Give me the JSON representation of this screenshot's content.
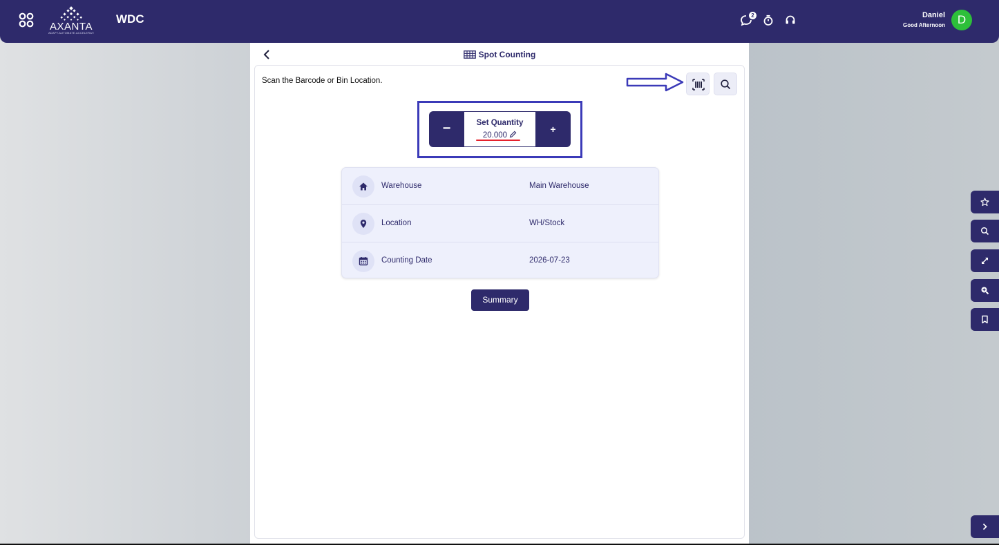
{
  "header": {
    "logo_text": "AXANTA",
    "logo_tagline": "ADAPT.AUTOMATE.ACCELERATE.",
    "app_name": "WDC",
    "notification_count": "2",
    "user_name": "Daniel",
    "greeting": "Good Afternoon",
    "avatar_initial": "D"
  },
  "page": {
    "title": "Spot Counting",
    "scan_prompt": "Scan the Barcode or Bin Location."
  },
  "quantity": {
    "label": "Set Quantity",
    "value": "20.000",
    "minus": "−",
    "plus": "+"
  },
  "info": {
    "rows": [
      {
        "label": "Warehouse",
        "value": "Main Warehouse",
        "icon": "home-icon"
      },
      {
        "label": "Location",
        "value": "WH/Stock",
        "icon": "map-pin-icon"
      },
      {
        "label": "Counting Date",
        "value": "2026-07-23",
        "icon": "calendar-icon"
      }
    ]
  },
  "actions": {
    "summary_label": "Summary"
  },
  "colors": {
    "primary": "#2e2a6b",
    "avatar": "#2dbf3a",
    "highlight": "#3b3ab8",
    "underline": "#e5212c"
  }
}
